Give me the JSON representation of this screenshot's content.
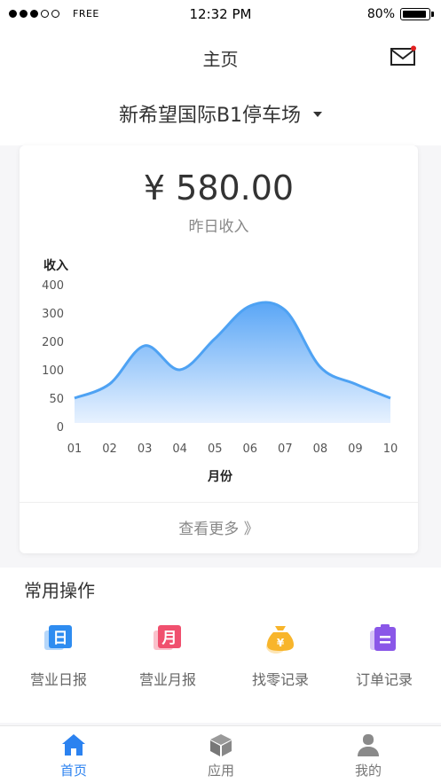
{
  "status_bar": {
    "carrier": "FREE",
    "time": "12:32 PM",
    "battery": "80%",
    "signal_bars_filled": 3,
    "signal_bars_total": 5
  },
  "nav": {
    "title": "主页"
  },
  "store": {
    "name": "新希望国际B1停车场"
  },
  "revenue": {
    "amount": "¥ 580.00",
    "label": "昨日收入"
  },
  "chart_data": {
    "type": "area",
    "ylabel": "收入",
    "xlabel": "月份",
    "categories": [
      "01",
      "02",
      "03",
      "04",
      "05",
      "06",
      "07",
      "08",
      "09",
      "10"
    ],
    "y_ticks": [
      "400",
      "300",
      "200",
      "100",
      "50",
      "0"
    ],
    "values": [
      50,
      75,
      185,
      100,
      210,
      325,
      310,
      110,
      75,
      50
    ],
    "fill_color_top": "#5aa6f6",
    "fill_color_bottom": "#e8f2ff",
    "line_color": "#4ea2f3"
  },
  "view_more": "查看更多 》",
  "quick_ops": {
    "title": "常用操作",
    "items": [
      {
        "label": "营业日报",
        "icon": "daily-report-icon",
        "glyph": "日",
        "color": "#2e8cf0"
      },
      {
        "label": "营业月报",
        "icon": "monthly-report-icon",
        "glyph": "月",
        "color": "#f0506e"
      },
      {
        "label": "找零记录",
        "icon": "change-record-icon",
        "glyph": "¥",
        "color": "#f8b52b"
      },
      {
        "label": "订单记录",
        "icon": "order-record-icon",
        "glyph": "",
        "color": "#8a57e8"
      }
    ]
  },
  "tabs": [
    {
      "label": "首页",
      "icon": "home-icon",
      "active": true
    },
    {
      "label": "应用",
      "icon": "apps-box-icon",
      "active": false
    },
    {
      "label": "我的",
      "icon": "profile-icon",
      "active": false
    }
  ],
  "colors": {
    "accent": "#2b82f0",
    "notification_dot": "#e02020"
  }
}
